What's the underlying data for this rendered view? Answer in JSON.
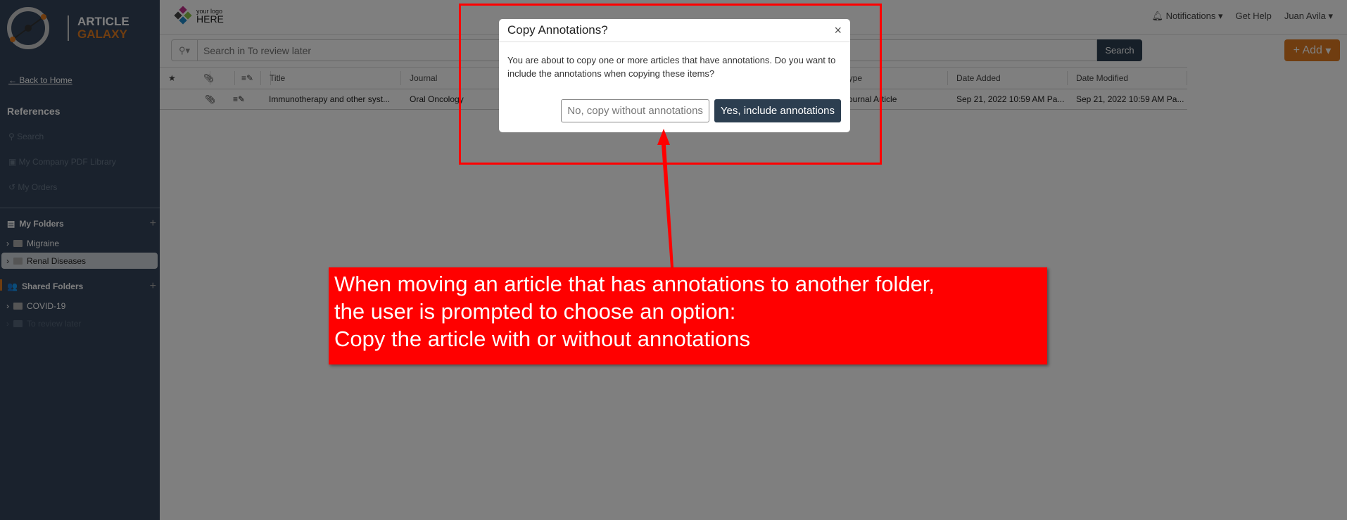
{
  "sidebar": {
    "logo": {
      "line1": "ARTICLE",
      "line2": "GALAXY"
    },
    "back_label": "Back to Home",
    "references_title": "References",
    "nav": [
      {
        "label": "Search",
        "icon": "search-icon"
      },
      {
        "label": "My Company PDF Library",
        "icon": "pdf-library-icon"
      },
      {
        "label": "My Orders",
        "icon": "history-icon"
      }
    ],
    "my_folders": {
      "title": "My Folders",
      "items": [
        "Migraine",
        "Renal Diseases"
      ],
      "selected": "Renal Diseases"
    },
    "shared_folders": {
      "title": "Shared Folders",
      "items": [
        "COVID-19",
        "To review later"
      ]
    }
  },
  "topbar": {
    "logo": {
      "small": "your logo",
      "big": "HERE"
    },
    "notifications": "Notifications",
    "help": "Get Help",
    "user": "Juan Avila"
  },
  "search": {
    "placeholder": "Search in To review later",
    "button": "Search"
  },
  "add_button": "+ Add",
  "table": {
    "headers": {
      "title": "Title",
      "journal": "Journal",
      "type": "Type",
      "date_added": "Date Added",
      "date_modified": "Date Modified"
    },
    "rows": [
      {
        "title": "Immunotherapy and other syst...",
        "journal": "Oral Oncology",
        "type": "Journal Article",
        "date_added": "Sep 21, 2022 10:59 AM Pa...",
        "date_modified": "Sep 21, 2022 10:59 AM Pa..."
      }
    ]
  },
  "dialog": {
    "title": "Copy Annotations?",
    "close": "×",
    "message": "You are about to copy one or more articles that have annotations. Do you want to include the annotations when copying these items?",
    "no_button": "No, copy without annotations",
    "yes_button": "Yes, include annotations"
  },
  "annotation": {
    "lines": [
      "When moving an article that has annotations to another folder,",
      "the user is prompted to choose an option:",
      "Copy the article with or without annotations"
    ],
    "color": "#ff0000"
  }
}
